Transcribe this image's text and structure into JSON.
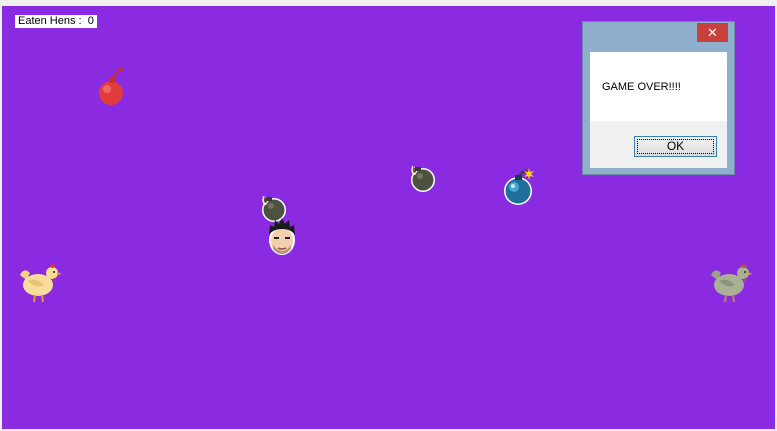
{
  "hud": {
    "score_label": "Eaten Hens :",
    "score_value": "0"
  },
  "dialog": {
    "message": "GAME OVER!!!!",
    "ok_label": "OK",
    "close_glyph": "✕"
  },
  "colors": {
    "game_background": "#8a2be2",
    "close_button": "#c7403c",
    "dialog_frame": "#8fb0cc"
  },
  "sprites": [
    {
      "name": "red-bomb-icon"
    },
    {
      "name": "grenade-icon"
    },
    {
      "name": "grenade-icon"
    },
    {
      "name": "blue-bomb-icon"
    },
    {
      "name": "player-face-icon"
    },
    {
      "name": "hen-icon"
    },
    {
      "name": "hen-icon"
    }
  ]
}
